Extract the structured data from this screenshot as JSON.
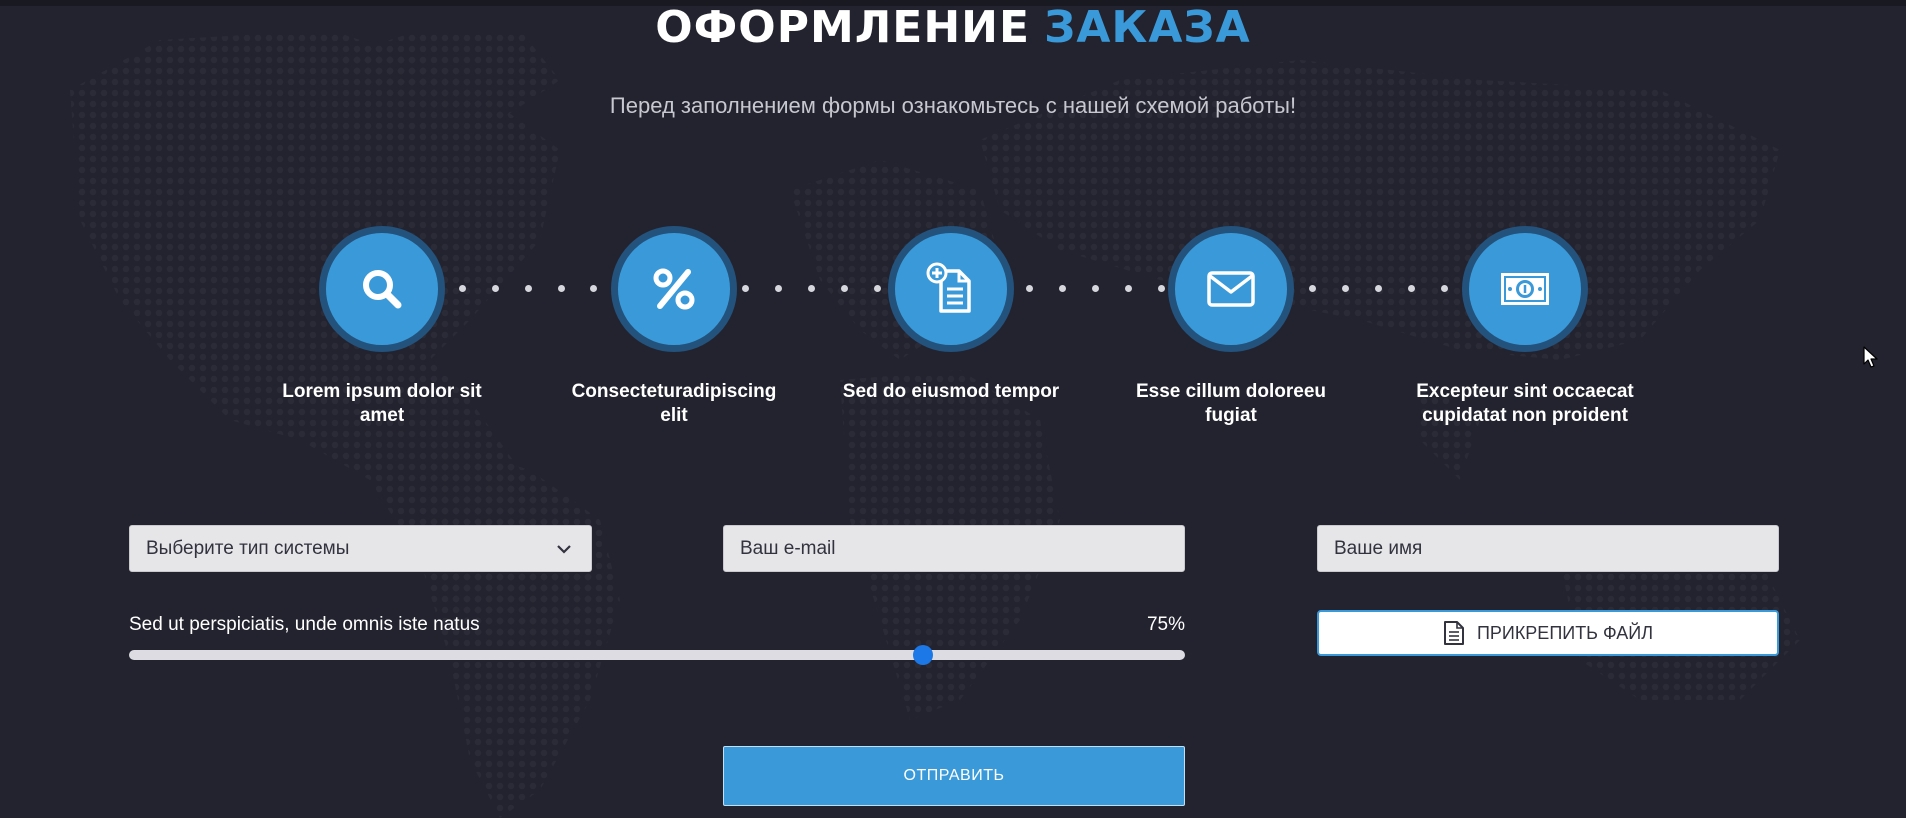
{
  "header": {
    "title_main": "ОФОРМЛЕНИЕ",
    "title_accent": "ЗАКАЗА",
    "subtitle": "Перед заполнением формы ознакомьтесь с нашей схемой работы!"
  },
  "steps": [
    {
      "icon": "search-icon",
      "label": "Lorem ipsum dolor sit amet"
    },
    {
      "icon": "percent-icon",
      "label": "Consecteturadipiscing elit"
    },
    {
      "icon": "document-add-icon",
      "label": "Sed do eiusmod tempor"
    },
    {
      "icon": "envelope-icon",
      "label": "Esse cillum doloreeu fugiat"
    },
    {
      "icon": "banknote-icon",
      "label": "Excepteur sint occaecat cupidatat non proident"
    }
  ],
  "form": {
    "system_select": {
      "value": "Выберите тип системы"
    },
    "email_field": {
      "placeholder": "Ваш e-mail"
    },
    "name_field": {
      "placeholder": "Ваше имя"
    },
    "slider": {
      "label": "Sed ut perspiciatis, unde omnis iste natus",
      "value_text": "75%",
      "value": 0.75
    },
    "attach_label": "ПРИКРЕПИТЬ ФАЙЛ",
    "submit_label": "ОТПРАВИТЬ"
  },
  "colors": {
    "background": "#23232f",
    "accent": "#3a9ad9",
    "circle_ring": "#23527c",
    "slider_thumb": "#1b78e6"
  }
}
